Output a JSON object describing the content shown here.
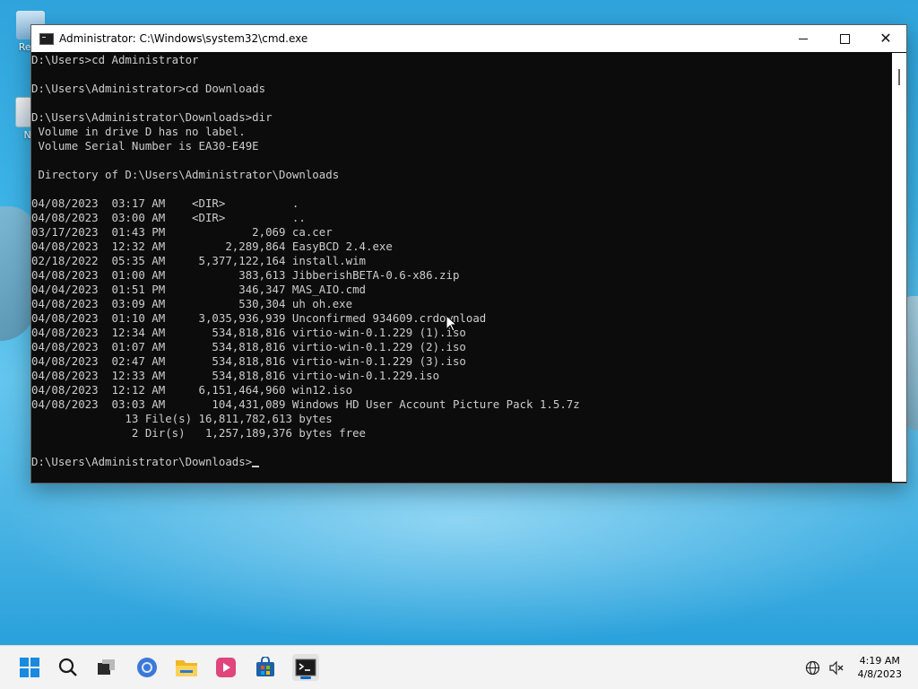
{
  "desktop": {
    "icons": [
      {
        "label": "Recy"
      },
      {
        "label": "No"
      }
    ]
  },
  "window": {
    "title": "Administrator: C:\\Windows\\system32\\cmd.exe",
    "minimize_glyph": "",
    "maximize_glyph": "",
    "close_glyph": "✕"
  },
  "console": {
    "lines": [
      "D:\\Users>cd Administrator",
      "",
      "D:\\Users\\Administrator>cd Downloads",
      "",
      "D:\\Users\\Administrator\\Downloads>dir",
      " Volume in drive D has no label.",
      " Volume Serial Number is EA30-E49E",
      "",
      " Directory of D:\\Users\\Administrator\\Downloads",
      "",
      "04/08/2023  03:17 AM    <DIR>          .",
      "04/08/2023  03:00 AM    <DIR>          ..",
      "03/17/2023  01:43 PM             2,069 ca.cer",
      "04/08/2023  12:32 AM         2,289,864 EasyBCD 2.4.exe",
      "02/18/2022  05:35 AM     5,377,122,164 install.wim",
      "04/08/2023  01:00 AM           383,613 JibberishBETA-0.6-x86.zip",
      "04/04/2023  01:51 PM           346,347 MAS_AIO.cmd",
      "04/08/2023  03:09 AM           530,304 uh oh.exe",
      "04/08/2023  01:10 AM     3,035,936,939 Unconfirmed 934609.crdownload",
      "04/08/2023  12:34 AM       534,818,816 virtio-win-0.1.229 (1).iso",
      "04/08/2023  01:07 AM       534,818,816 virtio-win-0.1.229 (2).iso",
      "04/08/2023  02:47 AM       534,818,816 virtio-win-0.1.229 (3).iso",
      "04/08/2023  12:33 AM       534,818,816 virtio-win-0.1.229.iso",
      "04/08/2023  12:12 AM     6,151,464,960 win12.iso",
      "04/08/2023  03:03 AM       104,431,089 Windows HD User Account Picture Pack 1.5.7z",
      "              13 File(s) 16,811,782,613 bytes",
      "               2 Dir(s)   1,257,189,376 bytes free",
      "",
      "D:\\Users\\Administrator\\Downloads>"
    ]
  },
  "taskbar": {
    "items": [
      {
        "name": "start-button",
        "icon": "windows-logo-icon"
      },
      {
        "name": "search-button",
        "icon": "search-icon"
      },
      {
        "name": "task-view-button",
        "icon": "task-view-icon"
      },
      {
        "name": "browser-button",
        "icon": "browser-icon"
      },
      {
        "name": "file-explorer-button",
        "icon": "folder-icon"
      },
      {
        "name": "media-player-button",
        "icon": "media-player-icon"
      },
      {
        "name": "store-button",
        "icon": "store-icon"
      },
      {
        "name": "terminal-button",
        "icon": "terminal-icon",
        "active": true
      }
    ],
    "tray": {
      "network_icon": "network-globe-icon",
      "volume_icon": "volume-muted-icon"
    },
    "clock": {
      "time": "4:19 AM",
      "date": "4/8/2023"
    }
  },
  "colors": {
    "console_bg": "#0c0c0c",
    "console_fg": "#cccccc",
    "accent": "#0067c0"
  }
}
